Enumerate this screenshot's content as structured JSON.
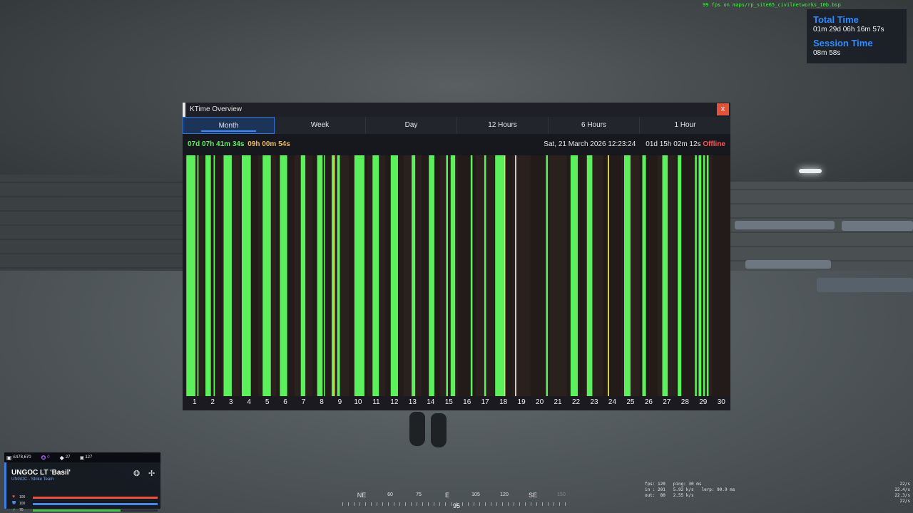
{
  "hud": {
    "debug_text": "99 fps on maps/rp_site65_civilnetworks_10b.bsp",
    "time_panel": {
      "total_time_label": "Total Time",
      "total_time_value": "01m 29d 06h 16m 57s",
      "session_time_label": "Session Time",
      "session_time_value": "08m 58s"
    },
    "player": {
      "money": "£478,670",
      "points": "0",
      "gems": "27",
      "photos": "127",
      "name": "UNGOC LT 'Basil'",
      "team": "UNGOC - Strike Team",
      "health": {
        "value": "100",
        "fraction": 1.0,
        "color": "#e8553f"
      },
      "armor": {
        "value": "100",
        "fraction": 1.0,
        "color": "#4a86e8"
      },
      "stamina": {
        "value": "70",
        "fraction": 0.7,
        "color": "#49c24d"
      }
    },
    "compass": {
      "marks": [
        "NE",
        "60",
        "75",
        "E",
        "105",
        "120",
        "SE",
        "150"
      ],
      "heading": "95"
    },
    "net_graph": {
      "lines": [
        "fps: 120   ping: 30 ms",
        "in : 201   5.92 k/s   lerp: 90.9 ms",
        "out:  80   2.55 k/s"
      ],
      "right_lines": [
        "22/s",
        "22.4/s",
        "22.3/s",
        "22/s"
      ]
    }
  },
  "window": {
    "title": "KTime Overview",
    "close_label": "x",
    "tabs": [
      {
        "label": "Month",
        "active": true
      },
      {
        "label": "Week",
        "active": false
      },
      {
        "label": "Day",
        "active": false
      },
      {
        "label": "12 Hours",
        "active": false
      },
      {
        "label": "6 Hours",
        "active": false
      },
      {
        "label": "1 Hour",
        "active": false
      }
    ],
    "online_total": "07d 07h 41m 34s",
    "away_total": "09h 00m 54s",
    "datetime": "Sat, 21 March 2026 12:23:24",
    "offline_duration": "01d 15h 02m 12s",
    "status": "Offline"
  },
  "colors": {
    "online": "#5df05d",
    "away": "#f0e060",
    "current": "#ffffff",
    "day_bg_a": "#2a211f",
    "day_bg_b": "#221b19"
  },
  "chart_data": {
    "type": "bar",
    "description_units": "activity segments per day, fraction of day [start, end]",
    "categories": [
      "1",
      "2",
      "3",
      "4",
      "5",
      "6",
      "7",
      "8",
      "9",
      "10",
      "11",
      "12",
      "13",
      "14",
      "15",
      "16",
      "17",
      "18",
      "19",
      "20",
      "21",
      "22",
      "23",
      "24",
      "25",
      "26",
      "27",
      "28",
      "29",
      "30"
    ],
    "series": [
      {
        "name": "online",
        "segments": [
          [
            [
              0.05,
              0.55
            ],
            [
              0.65,
              0.72
            ]
          ],
          [
            [
              0.1,
              0.4
            ],
            [
              0.55,
              0.62
            ]
          ],
          [
            [
              0.1,
              0.55
            ]
          ],
          [
            [
              0.1,
              0.6
            ]
          ],
          [
            [
              0.25,
              0.7
            ]
          ],
          [
            [
              0.2,
              0.6
            ]
          ],
          [
            [
              0.35,
              0.6
            ]
          ],
          [
            [
              0.25,
              0.55
            ],
            [
              0.62,
              0.68
            ]
          ],
          [
            [
              0.05,
              0.15
            ],
            [
              0.35,
              0.5
            ]
          ],
          [
            [
              0.3,
              0.85
            ]
          ],
          [
            [
              0.3,
              0.65
            ]
          ],
          [
            [
              0.3,
              0.7
            ]
          ],
          [
            [
              0.45,
              0.65
            ]
          ],
          [
            [
              0.4,
              0.7
            ]
          ],
          [
            [
              0.35,
              0.45
            ],
            [
              0.6,
              0.85
            ]
          ],
          [
            [
              0.7,
              0.8
            ]
          ],
          [
            [
              0.45,
              0.55
            ]
          ],
          [
            [
              0.05,
              0.55
            ]
          ],
          [],
          [
            [
              0.85,
              0.95
            ]
          ],
          [],
          [
            [
              0.2,
              0.6
            ]
          ],
          [
            [
              0.1,
              0.4
            ]
          ],
          [],
          [
            [
              0.15,
              0.5
            ]
          ],
          [
            [
              0.15,
              0.35
            ]
          ],
          [
            [
              0.25,
              0.55
            ]
          ],
          [
            [
              0.1,
              0.3
            ]
          ],
          [
            [
              0.05,
              0.15
            ],
            [
              0.25,
              0.4
            ],
            [
              0.5,
              0.6
            ],
            [
              0.7,
              0.8
            ]
          ],
          []
        ]
      },
      {
        "name": "away",
        "segments": [
          [],
          [],
          [],
          [],
          [],
          [],
          [],
          [],
          [
            [
              0.15,
              0.22
            ]
          ],
          [],
          [],
          [],
          [],
          [],
          [],
          [],
          [],
          [
            [
              0.55,
              0.6
            ]
          ],
          [],
          [],
          [],
          [],
          [],
          [
            [
              0.25,
              0.32
            ]
          ],
          [],
          [],
          [],
          [],
          [],
          []
        ]
      },
      {
        "name": "current",
        "segments": [
          [],
          [],
          [],
          [],
          [],
          [],
          [],
          [],
          [],
          [],
          [],
          [],
          [],
          [],
          [],
          [],
          [],
          [],
          [],
          [],
          [
            [
              0.0,
              0.0
            ]
          ],
          [],
          [],
          [],
          [],
          [],
          [],
          [],
          [],
          []
        ]
      }
    ],
    "current_marker": {
      "day": "19",
      "position": 0.15
    },
    "ylim": [
      0,
      1
    ]
  }
}
